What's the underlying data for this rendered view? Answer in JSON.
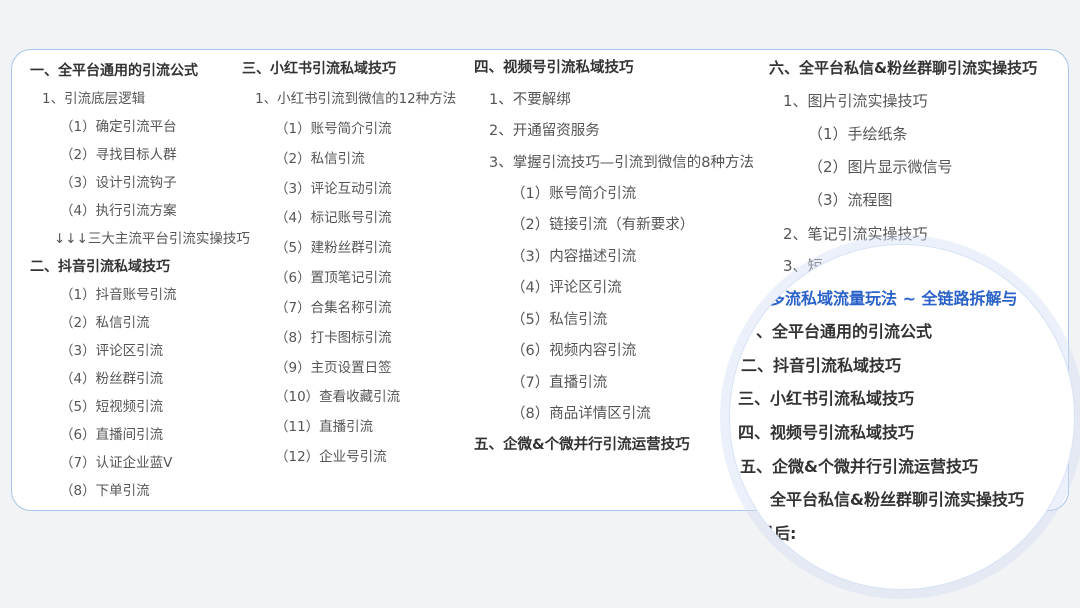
{
  "col1": {
    "heading1": "一、全平台通用的引流公式",
    "item1": "1、引流底层逻辑",
    "steps": [
      "（1）确定引流平台",
      "（2）寻找目标人群",
      "（3）设计引流钩子",
      "（4）执行引流方案"
    ],
    "arrow_note": "↓↓↓三大主流平台引流实操技巧",
    "heading2": "二、抖音引流私域技巧",
    "douyin_items": [
      "（1）抖音账号引流",
      "（2）私信引流",
      "（3）评论区引流",
      "（4）粉丝群引流",
      "（5）短视频引流",
      "（6）直播间引流",
      "（7）认证企业蓝V",
      "（8）下单引流"
    ]
  },
  "col2": {
    "heading": "三、小红书引流私域技巧",
    "item1": "1、小红书引流到微信的12种方法",
    "items": [
      "（1）账号简介引流",
      "（2）私信引流",
      "（3）评论互动引流",
      "（4）标记账号引流",
      "（5）建粉丝群引流",
      "（6）置顶笔记引流",
      "（7）合集名称引流",
      "（8）打卡图标引流",
      "（9）主页设置日签",
      "（10）查看收藏引流",
      "（11）直播引流",
      "（12）企业号引流"
    ]
  },
  "col3": {
    "heading": "四、视频号引流私域技巧",
    "items": [
      "1、不要解绑",
      "2、开通留资服务",
      "3、掌握引流技巧—引流到微信的8种方法"
    ],
    "subitems": [
      "（1）账号简介引流",
      "（2）链接引流（有新要求）",
      "（3）内容描述引流",
      "（4）评论区引流",
      "（5）私信引流",
      "（6）视频内容引流",
      "（7）直播引流",
      "（8）商品详情区引流"
    ],
    "heading5": "五、企微&个微并行引流运营技巧"
  },
  "col4": {
    "heading": "六、全平台私信&粉丝群聊引流实操技巧",
    "item1": "1、图片引流实操技巧",
    "subitems": [
      "（1）手绘纸条",
      "（2）图片显示微信号",
      "（3）流程图"
    ],
    "item2": "2、笔记引流实操技巧",
    "item3_partial": "3、短"
  },
  "magnifier": {
    "title": "多流私域流量玩法 ~ 全链路拆解与",
    "lines": [
      "、全平台通用的引流公式",
      "二、抖音引流私域技巧",
      "三、小红书引流私域技巧",
      "四、视频号引流私域技巧",
      "五、企微&个微并行引流运营技巧",
      "全平台私信&粉丝群聊引流实操技巧",
      "最后:"
    ]
  },
  "colors": {
    "accent_border": "#a9c4ec",
    "title_blue": "#2a62c8",
    "background": "#f2f3f5"
  }
}
